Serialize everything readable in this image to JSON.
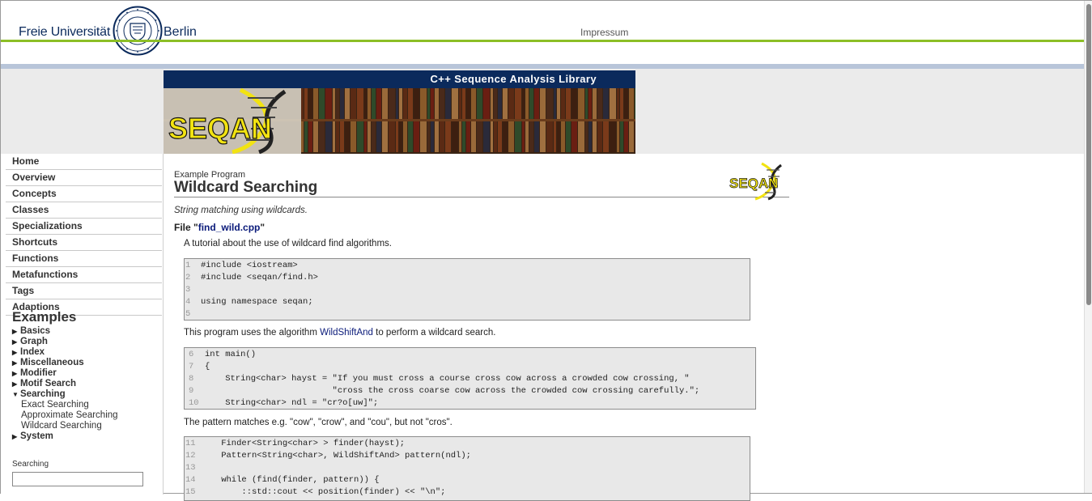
{
  "header": {
    "logo_left": "Freie Universität",
    "logo_right": "Berlin",
    "impressum": "Impressum"
  },
  "banner": {
    "tagline": "C++ Sequence Analysis Library",
    "logo_text": "SEQAN"
  },
  "sidebar": {
    "nav": [
      {
        "label": "Home"
      },
      {
        "label": "Overview"
      },
      {
        "label": "Concepts"
      },
      {
        "label": "Classes"
      },
      {
        "label": "Specializations"
      },
      {
        "label": "Shortcuts"
      },
      {
        "label": "Functions"
      },
      {
        "label": "Metafunctions"
      },
      {
        "label": "Tags"
      },
      {
        "label": "Adaptions"
      }
    ],
    "examples_title": "Examples",
    "examples": [
      {
        "label": "Basics"
      },
      {
        "label": "Graph"
      },
      {
        "label": "Index"
      },
      {
        "label": "Miscellaneous"
      },
      {
        "label": "Modifier"
      },
      {
        "label": "Motif Search"
      },
      {
        "label": "Searching",
        "children": [
          "Exact Searching",
          "Approximate Searching",
          "Wildcard Searching"
        ]
      },
      {
        "label": "System"
      }
    ],
    "search_label": "Searching",
    "search_value": ""
  },
  "content": {
    "kicker": "Example Program",
    "title": "Wildcard Searching",
    "mini_logo": "SEQAN",
    "description": "String matching using wildcards.",
    "file_prefix": "File \"",
    "file_name": "find_wild.cpp",
    "file_suffix": "\"",
    "para1": "A tutorial about the use of wildcard find algorithms.",
    "code1": [
      {
        "n": "1",
        "code": "#include <iostream>"
      },
      {
        "n": "2",
        "code": "#include <seqan/find.h>"
      },
      {
        "n": "3",
        "code": ""
      },
      {
        "n": "4",
        "code": "using namespace seqan;"
      },
      {
        "n": "5",
        "code": ""
      }
    ],
    "para2_prefix": "This program uses the algorithm ",
    "para2_link": "WildShiftAnd",
    "para2_suffix": " to perform a wildcard search.",
    "code2": [
      {
        "n": "6",
        "code": "int main()"
      },
      {
        "n": "7",
        "code": "{"
      },
      {
        "n": "8",
        "code": "    String<char> hayst = \"If you must cross a course cross cow across a crowded cow crossing, \""
      },
      {
        "n": "9",
        "code": "                         \"cross the cross coarse cow across the crowded cow crossing carefully.\";"
      },
      {
        "n": "10",
        "code": "    String<char> ndl = \"cr?o[uw]\";"
      }
    ],
    "para3": "The pattern matches e.g. \"cow\", \"crow\", and \"cou\", but not \"cros\".",
    "code3": [
      {
        "n": "11",
        "code": "    Finder<String<char> > finder(hayst);"
      },
      {
        "n": "12",
        "code": "    Pattern<String<char>, WildShiftAnd> pattern(ndl);"
      },
      {
        "n": "13",
        "code": ""
      },
      {
        "n": "14",
        "code": "    while (find(finder, pattern)) {"
      },
      {
        "n": "15",
        "code": "        ::std::cout << position(finder) << \"\\n\";"
      }
    ]
  },
  "colors": {
    "fu_blue": "#0b2a5c",
    "fu_green": "#8cbf26",
    "seqan_yellow": "#f2e312",
    "link": "#0a1a7a"
  }
}
